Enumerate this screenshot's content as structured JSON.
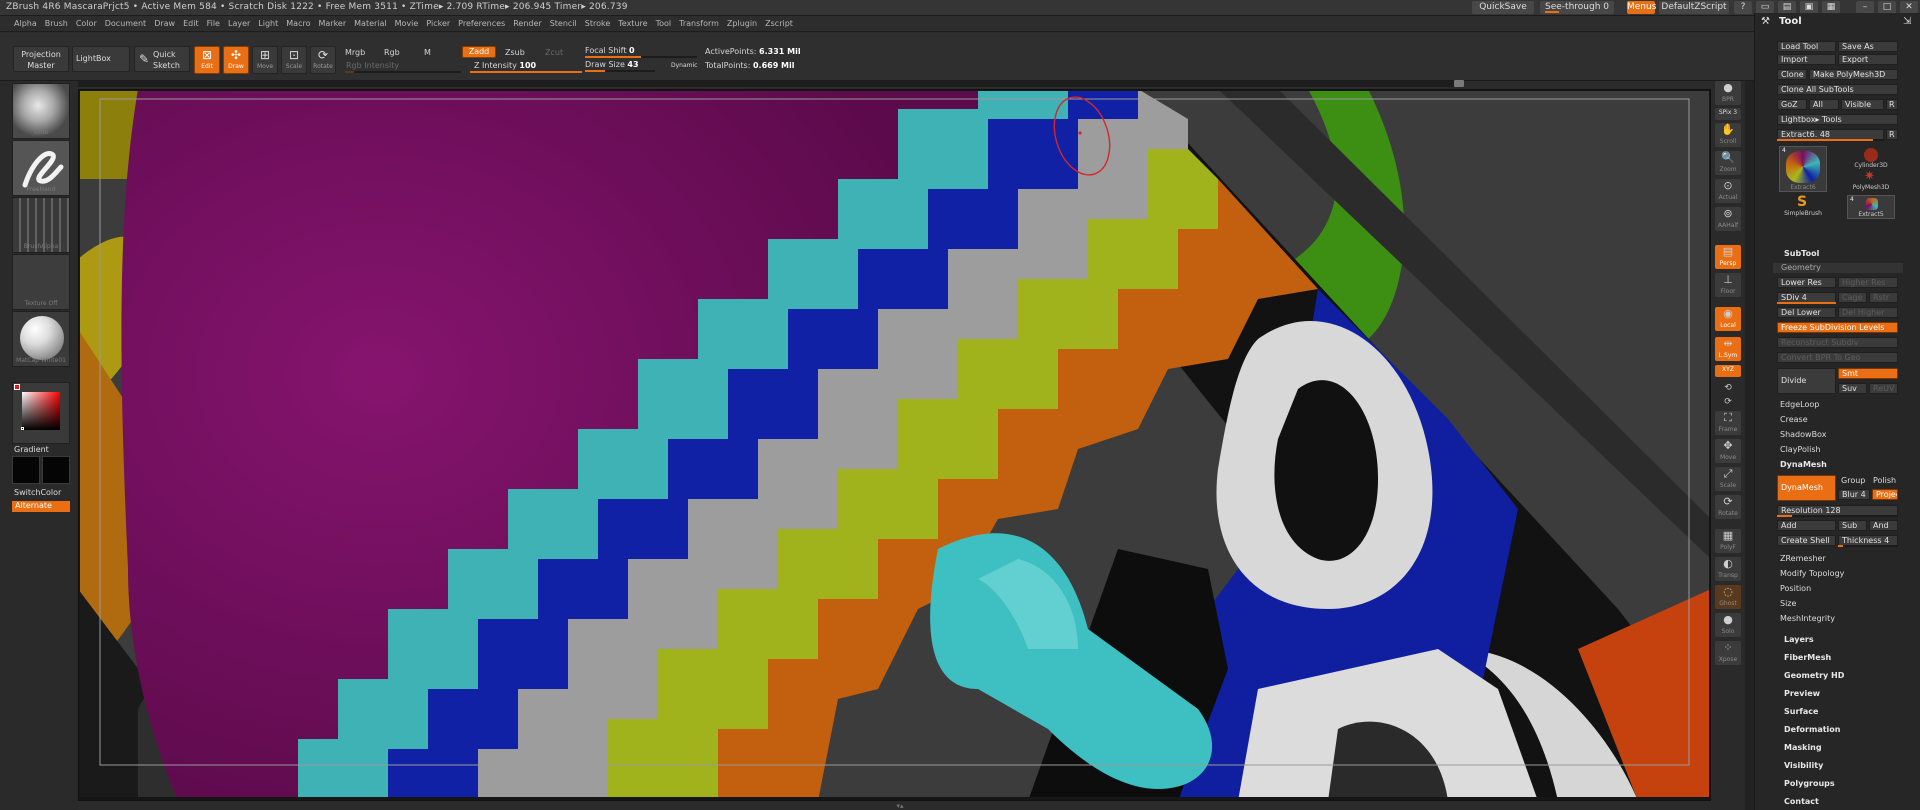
{
  "titlebar": {
    "info": "ZBrush 4R6   MascaraPrjct5  • Active Mem 584 • Scratch Disk 1222 • Free Mem 3511 • ZTime▸ 2.709 RTime▸ 206.945 Timer▸ 206.739",
    "quicksave": "QuickSave",
    "see_through": "See-through  0",
    "menus": "Menus",
    "default_zscript": "DefaultZScript"
  },
  "menubar": [
    "Alpha",
    "Brush",
    "Color",
    "Document",
    "Draw",
    "Edit",
    "File",
    "Layer",
    "Light",
    "Macro",
    "Marker",
    "Material",
    "Movie",
    "Picker",
    "Preferences",
    "Render",
    "Stencil",
    "Stroke",
    "Texture",
    "Tool",
    "Transform",
    "Zplugin",
    "Zscript"
  ],
  "shelf": {
    "projection_master": "Projection Master",
    "lightbox": "LightBox",
    "quick_sketch": "Quick Sketch",
    "edit": "Edit",
    "draw": "Draw",
    "move": "Move",
    "scale": "Scale",
    "rotate": "Rotate",
    "mrgb": "Mrgb",
    "rgb": "Rgb",
    "m": "M",
    "rgb_intensity": "Rgb Intensity",
    "zadd": "Zadd",
    "zsub": "Zsub",
    "zcut": "Zcut",
    "z_intensity_label": "Z Intensity",
    "z_intensity": "100",
    "focal_shift_label": "Focal Shift",
    "focal_shift": "0",
    "draw_size_label": "Draw Size",
    "draw_size": "43",
    "dynamic": "Dynamic",
    "active_points_label": "ActivePoints:",
    "active_points": "6.331  Mil",
    "total_points_label": "TotalPoints:",
    "total_points": "0.669  Mil"
  },
  "left": {
    "brush": "Slide",
    "stroke": "FreeHand",
    "alpha": "BrushAlpha",
    "texture": "Texture Off",
    "material": "MatCap White01",
    "gradient": "Gradient",
    "switch_color": "SwitchColor",
    "alternate": "Alternate"
  },
  "right_shelf": [
    {
      "name": "bpr",
      "label": "BPR"
    },
    {
      "name": "spix",
      "label": "SPix 3"
    },
    {
      "name": "scroll",
      "label": "Scroll"
    },
    {
      "name": "zoom",
      "label": "Zoom"
    },
    {
      "name": "actual",
      "label": "Actual"
    },
    {
      "name": "aahalf",
      "label": "AAHalf"
    },
    {
      "name": "persp",
      "label": "Persp"
    },
    {
      "name": "floor",
      "label": "Floor"
    },
    {
      "name": "local",
      "label": "Local"
    },
    {
      "name": "lsym",
      "label": "L.Sym"
    },
    {
      "name": "xyz",
      "label": "XYZ"
    },
    {
      "name": "frame",
      "label": "Frame"
    },
    {
      "name": "move",
      "label": "Move"
    },
    {
      "name": "scale",
      "label": "Scale"
    },
    {
      "name": "rotate",
      "label": "Rotate"
    },
    {
      "name": "polyf",
      "label": "PolyF"
    },
    {
      "name": "transp",
      "label": "Transp"
    },
    {
      "name": "ghost",
      "label": "Ghost"
    },
    {
      "name": "solo",
      "label": "Solo"
    },
    {
      "name": "xpose",
      "label": "Xpose"
    }
  ],
  "tool": {
    "title": "Tool",
    "load_tool": "Load Tool",
    "save_as": "Save As",
    "import": "Import",
    "export": "Export",
    "clone": "Clone",
    "make_polymesh": "Make PolyMesh3D",
    "clone_all": "Clone  All SubTools",
    "goz": "GoZ",
    "all": "All",
    "visible": "Visible",
    "r": "R",
    "lightbox_tools": "Lightbox▸ Tools",
    "extract_slider": "Extract6. 48",
    "thumbs": [
      {
        "label": "Extract6",
        "badge": "4"
      },
      {
        "label": "Cylinder3D",
        "badge": ""
      },
      {
        "label": "PolyMesh3D",
        "badge": ""
      },
      {
        "label": "SimpleBrush",
        "badge": ""
      },
      {
        "label": "Extract5",
        "badge": "4"
      }
    ],
    "subtool": "SubTool",
    "geometry": "Geometry",
    "lower_res": "Lower Res",
    "higher_res": "Higher Res",
    "sdiv": "SDiv 4",
    "cage": "Cage",
    "rstr": "Rstr",
    "del_lower": "Del Lower",
    "del_higher": "Del Higher",
    "freeze": "Freeze SubDivision Levels",
    "reconstruct": "Reconstruct Subdiv",
    "convert_bpr": "Convert BPR To Geo",
    "divide": "Divide",
    "smt": "Smt",
    "suv": "Suv",
    "reuv": "ReUV",
    "edgeloop": "EdgeLoop",
    "crease": "Crease",
    "shadowbox": "ShadowBox",
    "claypolish": "ClayPolish",
    "dynamesh_header": "DynaMesh",
    "dynamesh": "DynaMesh",
    "group": "Group",
    "polish": "Polish",
    "blur": "Blur 4",
    "project": "Projec",
    "resolution": "Resolution 128",
    "add": "Add",
    "sub": "Sub",
    "and": "And",
    "create_shell": "Create Shell",
    "thickness": "Thickness 4",
    "zremesher": "ZRemesher",
    "modify_topology": "Modify Topology",
    "position": "Position",
    "size": "Size",
    "meshintegrity": "MeshIntegrity",
    "sections": [
      "Layers",
      "FiberMesh",
      "Geometry HD",
      "Preview",
      "Surface",
      "Deformation",
      "Masking",
      "Visibility",
      "Polygroups",
      "Contact"
    ]
  },
  "colors": {
    "accent": "#ea6f14",
    "magenta": "#7a0e63",
    "cyan": "#3fb6b6",
    "blue": "#0f1fa3",
    "yellowgreen": "#a9b91d",
    "orange": "#c9620e",
    "green": "#3e9b16"
  }
}
